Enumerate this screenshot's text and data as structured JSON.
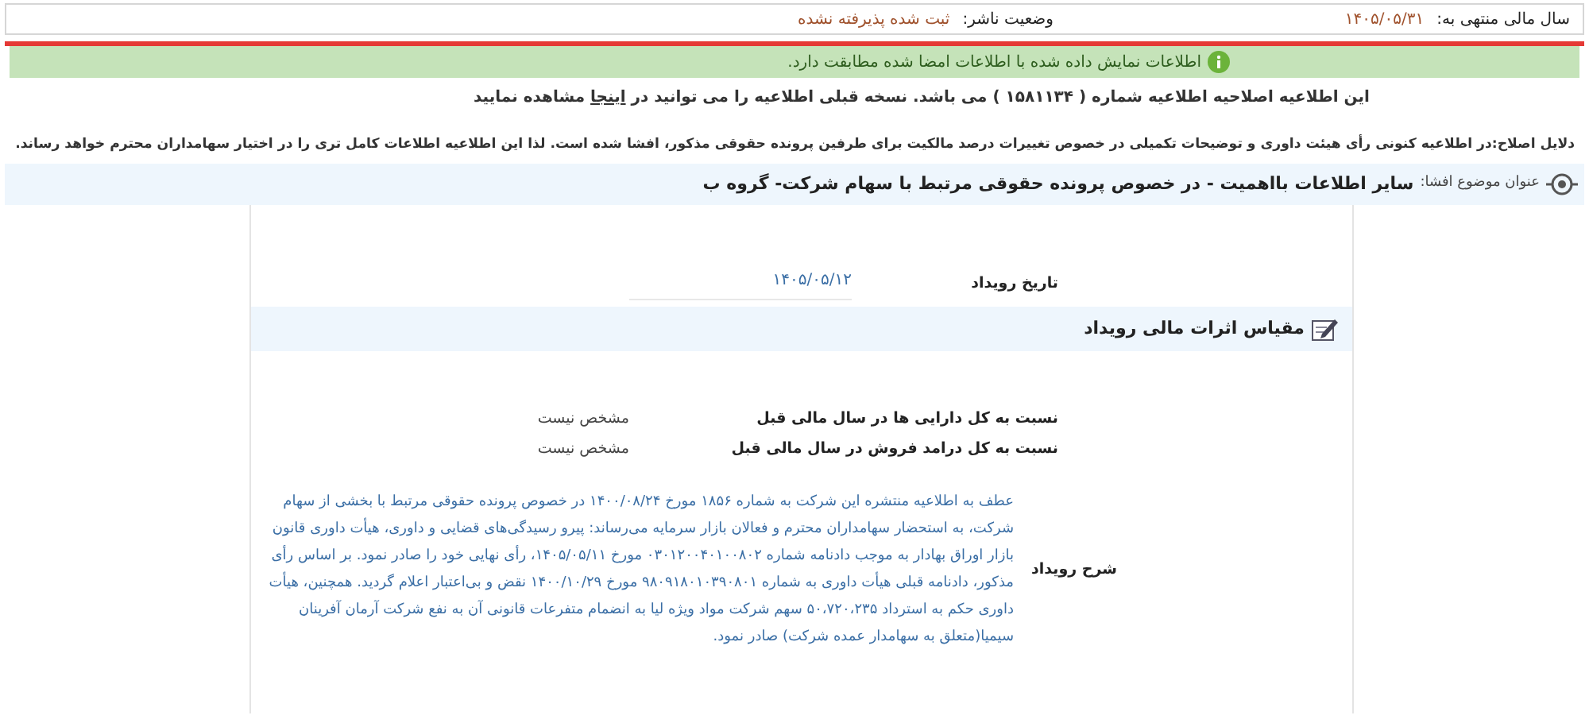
{
  "header": {
    "fiscal_year_label": "سال مالی منتهی به:",
    "fiscal_year_value": "۱۴۰۵/۰۵/۳۱",
    "publisher_status_label": "وضعیت ناشر:",
    "publisher_status_value": "ثبت شده پذیرفته نشده"
  },
  "verification_banner": {
    "text": "اطلاعات نمایش داده شده با اطلاعات امضا شده مطابقت دارد."
  },
  "correction_notice": {
    "before": "این اطلاعیه اصلاحیه اطلاعیه شماره ( ۱۵۸۱۱۳۴ ) می باشد. نسخه قبلی اطلاعیه را می توانید در",
    "link": "اینجا",
    "after": "مشاهده نمایید"
  },
  "correction_reason": "دلایل اصلاح:در اطلاعیه کنونی رأی هیئت داوری و توضیحات تکمیلی در خصوص تغییرات درصد مالکیت برای طرفین پرونده حقوقی مذکور، افشا شده است. لذا این اطلاعیه اطلاعات کامل تری را در اختیار سهامداران محترم خواهد رساند.",
  "subject": {
    "label": "عنوان موضوع افشا:",
    "title": "سایر اطلاعات بااهمیت - در خصوص پرونده حقوقی مرتبط با سهام شرکت- گروه ب"
  },
  "event_date": {
    "label": "تاریخ رویداد",
    "value": "۱۴۰۵/۰۵/۱۲"
  },
  "financial_impact": {
    "title": "مقیاس اثرات مالی رویداد",
    "rows": [
      {
        "label": "نسبت به کل دارایی ها در سال مالی قبل",
        "value": "مشخص نیست"
      },
      {
        "label": "نسبت به کل درامد فروش در سال مالی قبل",
        "value": "مشخص نیست"
      }
    ]
  },
  "event_description": {
    "label": "شرح رویداد",
    "text": "عطف به اطلاعیه منتشره این شرکت به شماره ۱۸۵۶ مورخ ۱۴۰۰/۰۸/۲۴ در خصوص پرونده حقوقی مرتبط با بخشی از سهام شرکت، به استحضار سهامداران محترم و فعالان بازار سرمایه می‌رساند: پیرو رسیدگی‌های قضایی و داوری، هیأت داوری قانون بازار اوراق بهادار به موجب دادنامه شماره ۰۳۰۱۲۰۰۴۰۱۰۰۸۰۲ مورخ ۱۴۰۵/۰۵/۱۱، رأی نهایی خود را صادر نمود. بر اساس رأی مذکور، دادنامه قبلی هیأت داوری به شماره ۹۸۰۹۱۸۰۱۰۳۹۰۸۰۱ مورخ ۱۴۰۰/۱۰/۲۹ نقض و بی‌اعتبار اعلام گردید. همچنین، هیأت داوری حکم به استرداد ۵۰،۷۲۰،۲۳۵ سهم شرکت مواد ویژه لیا به انضمام متفرعات قانونی آن به نفع شرکت آرمان آفرینان سیمیا(متعلق به سهامدار عمده شرکت) صادر نمود."
  }
}
